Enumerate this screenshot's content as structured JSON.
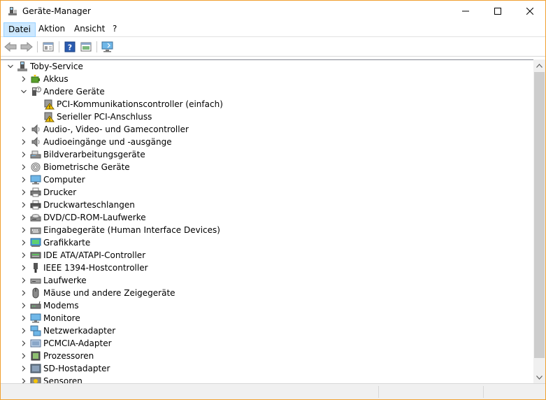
{
  "window": {
    "title": "Geräte-Manager",
    "border_color": "#f0a030"
  },
  "menubar": {
    "items": [
      "Datei",
      "Aktion",
      "Ansicht",
      "?"
    ]
  },
  "toolbar": {
    "buttons": [
      "back-icon",
      "forward-icon",
      "properties-icon",
      "help-icon",
      "view-icon",
      "monitor-scan-icon"
    ]
  },
  "tree": {
    "root": "Toby-Service",
    "items": [
      {
        "label": "Akkus",
        "icon": "battery-icon",
        "expanded": false,
        "level": 1
      },
      {
        "label": "Andere Geräte",
        "icon": "unknown-device-icon",
        "expanded": true,
        "level": 1
      },
      {
        "label": "PCI-Kommunikationscontroller (einfach)",
        "icon": "warning-device-icon",
        "level": 2
      },
      {
        "label": "Serieller PCI-Anschluss",
        "icon": "warning-device-icon",
        "level": 2
      },
      {
        "label": "Audio-, Video- und Gamecontroller",
        "icon": "speaker-icon",
        "expanded": false,
        "level": 1
      },
      {
        "label": "Audioeingänge und -ausgänge",
        "icon": "speaker-icon",
        "expanded": false,
        "level": 1
      },
      {
        "label": "Bildverarbeitungsgeräte",
        "icon": "scanner-icon",
        "expanded": false,
        "level": 1
      },
      {
        "label": "Biometrische Geräte",
        "icon": "fingerprint-icon",
        "expanded": false,
        "level": 1
      },
      {
        "label": "Computer",
        "icon": "computer-icon",
        "expanded": false,
        "level": 1
      },
      {
        "label": "Drucker",
        "icon": "printer-icon",
        "expanded": false,
        "level": 1
      },
      {
        "label": "Druckwarteschlangen",
        "icon": "print-queue-icon",
        "expanded": false,
        "level": 1
      },
      {
        "label": "DVD/CD-ROM-Laufwerke",
        "icon": "dvd-drive-icon",
        "expanded": false,
        "level": 1
      },
      {
        "label": "Eingabegeräte (Human Interface Devices)",
        "icon": "keyboard-icon",
        "expanded": false,
        "level": 1
      },
      {
        "label": "Grafikkarte",
        "icon": "display-adapter-icon",
        "expanded": false,
        "level": 1
      },
      {
        "label": "IDE ATA/ATAPI-Controller",
        "icon": "ide-controller-icon",
        "expanded": false,
        "level": 1
      },
      {
        "label": "IEEE 1394-Hostcontroller",
        "icon": "ieee1394-icon",
        "expanded": false,
        "level": 1
      },
      {
        "label": "Laufwerke",
        "icon": "disk-drive-icon",
        "expanded": false,
        "level": 1
      },
      {
        "label": "Mäuse und andere Zeigegeräte",
        "icon": "mouse-icon",
        "expanded": false,
        "level": 1
      },
      {
        "label": "Modems",
        "icon": "modem-icon",
        "expanded": false,
        "level": 1
      },
      {
        "label": "Monitore",
        "icon": "monitor-icon",
        "expanded": false,
        "level": 1
      },
      {
        "label": "Netzwerkadapter",
        "icon": "network-adapter-icon",
        "expanded": false,
        "level": 1
      },
      {
        "label": "PCMCIA-Adapter",
        "icon": "pcmcia-icon",
        "expanded": false,
        "level": 1
      },
      {
        "label": "Prozessoren",
        "icon": "processor-icon",
        "expanded": false,
        "level": 1
      },
      {
        "label": "SD-Hostadapter",
        "icon": "sd-host-icon",
        "expanded": false,
        "level": 1
      },
      {
        "label": "Sensoren",
        "icon": "sensor-icon",
        "expanded": false,
        "level": 1
      }
    ]
  },
  "colors": {
    "menu_highlight": "#cce8ff",
    "accent_blue": "#1e6fc8",
    "warning_yellow": "#f5c400"
  }
}
